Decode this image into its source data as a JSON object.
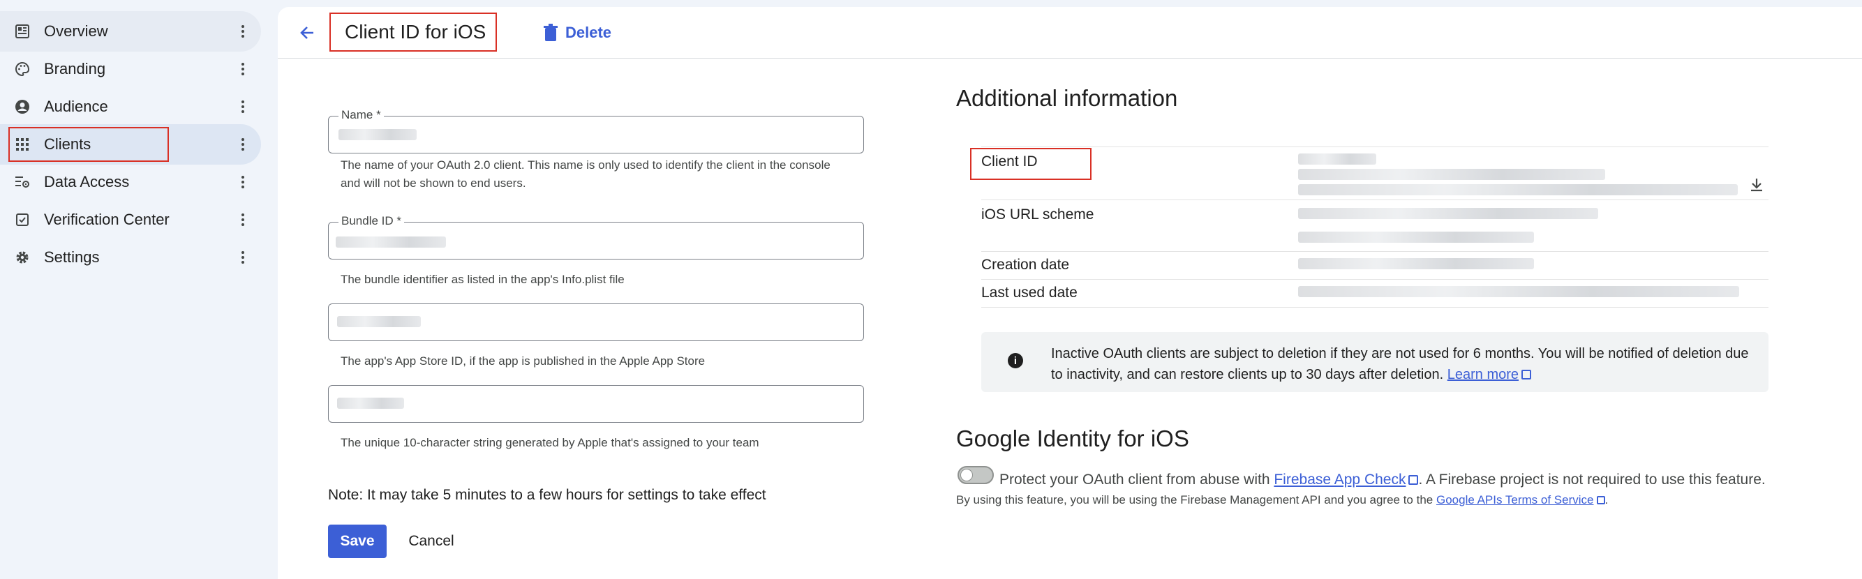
{
  "sidebar": {
    "items": [
      {
        "label": "Overview",
        "icon": "dashboard-icon"
      },
      {
        "label": "Branding",
        "icon": "palette-icon"
      },
      {
        "label": "Audience",
        "icon": "account-circle-icon"
      },
      {
        "label": "Clients",
        "icon": "apps-grid-icon",
        "active": true
      },
      {
        "label": "Data Access",
        "icon": "data-settings-icon"
      },
      {
        "label": "Verification Center",
        "icon": "verified-check-icon"
      },
      {
        "label": "Settings",
        "icon": "gear-icon"
      }
    ]
  },
  "header": {
    "title": "Client ID for iOS",
    "delete_label": "Delete"
  },
  "form": {
    "name_label": "Name *",
    "name_help": "The name of your OAuth 2.0 client. This name is only used to identify the client in the console and will not be shown to end users.",
    "bundle_label": "Bundle ID *",
    "bundle_help": "The bundle identifier as listed in the app's Info.plist file",
    "appstore_help": "The app's App Store ID, if the app is published in the Apple App Store",
    "team_help": "The unique 10-character string generated by Apple that's assigned to your team",
    "note": "Note: It may take 5 minutes to a few hours for settings to take effect",
    "save_label": "Save",
    "cancel_label": "Cancel"
  },
  "additional": {
    "heading": "Additional information",
    "rows": [
      "Client ID",
      "iOS URL scheme",
      "Creation date",
      "Last used date"
    ],
    "notice_text": "Inactive OAuth clients are subject to deletion if they are not used for 6 months. You will be notified of deletion due to inactivity, and can restore clients up to 30 days after deletion.",
    "notice_link": "Learn more"
  },
  "identity": {
    "heading": "Google Identity for iOS",
    "protect_prefix": "Protect your OAuth client from abuse with",
    "protect_link": "Firebase App Check",
    "protect_suffix": ". A Firebase project is not required to use this feature.",
    "terms_prefix": "By using this feature, you will be using the Firebase Management API and you agree to the",
    "terms_link": "Google APIs Terms of Service",
    "terms_suffix": "."
  },
  "colors": {
    "accent": "#3c5fd6",
    "highlight": "#d93025",
    "sidebar_bg": "#f0f4fa"
  }
}
